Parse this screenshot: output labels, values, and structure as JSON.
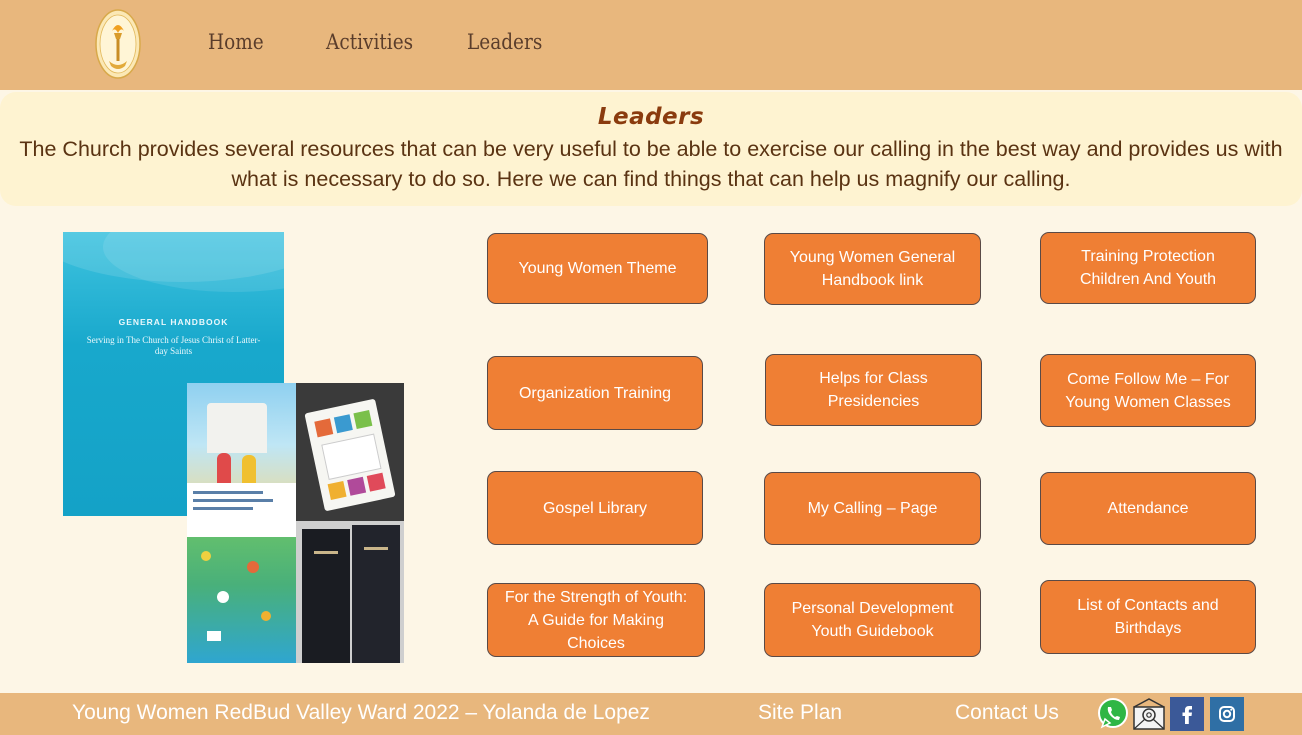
{
  "header": {
    "nav": [
      "Home",
      "Activities",
      "Leaders"
    ]
  },
  "banner": {
    "title": "Leaders",
    "text": "The Church provides several resources that can be very useful to be able to exercise our calling in the best way and provides us with what is necessary to do so. Here we can find things that can help us magnify our calling."
  },
  "handbook": {
    "title": "GENERAL HANDBOOK",
    "subtitle": "Serving in The Church of Jesus Christ of Latter-day Saints"
  },
  "buttons": [
    "Young Women Theme",
    "Young Women General Handbook link",
    "Training Protection Children And Youth",
    "Organization Training",
    "Helps for Class Presidencies",
    "Come Follow Me – For Young Women Classes",
    "Gospel Library",
    "My Calling – Page",
    "Attendance",
    "For the Strength of Youth: A Guide for Making Choices",
    "Personal Development Youth Guidebook",
    "List of Contacts and Birthdays"
  ],
  "footer": {
    "credit": "Young Women RedBud Valley Ward  2022 – Yolanda de Lopez",
    "site_plan": "Site Plan",
    "contact": "Contact Us"
  },
  "social_icons": [
    "whatsapp-icon",
    "email-icon",
    "facebook-icon",
    "instagram-icon"
  ],
  "colors": {
    "header_bg": "#e8b77d",
    "button_bg": "#ef7f34",
    "banner_bg": "#fef3d1",
    "page_bg": "#fdf6e6",
    "facebook": "#3b5998",
    "instagram": "#2f6fa5",
    "whatsapp": "#2fb645"
  }
}
